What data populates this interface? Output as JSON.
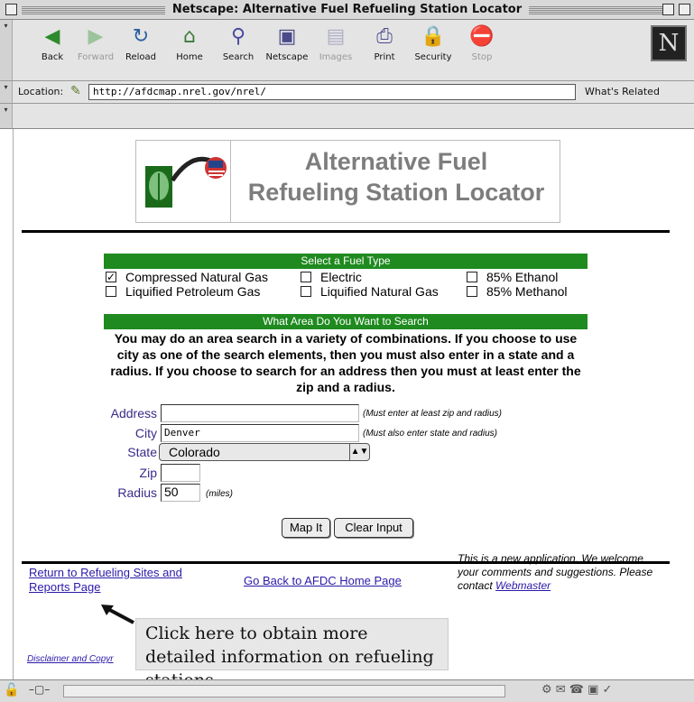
{
  "window": {
    "title": "Netscape: Alternative Fuel Refueling Station Locator"
  },
  "toolbar": {
    "buttons": [
      {
        "label": "Back",
        "icon": "back-arrow-icon",
        "enabled": true
      },
      {
        "label": "Forward",
        "icon": "forward-arrow-icon",
        "enabled": false
      },
      {
        "label": "Reload",
        "icon": "reload-icon",
        "enabled": true
      },
      {
        "label": "Home",
        "icon": "home-icon",
        "enabled": true
      },
      {
        "label": "Search",
        "icon": "search-icon",
        "enabled": true
      },
      {
        "label": "Netscape",
        "icon": "netscape-icon",
        "enabled": true
      },
      {
        "label": "Images",
        "icon": "images-icon",
        "enabled": false
      },
      {
        "label": "Print",
        "icon": "print-icon",
        "enabled": true
      },
      {
        "label": "Security",
        "icon": "security-lock-icon",
        "enabled": true
      },
      {
        "label": "Stop",
        "icon": "stop-icon",
        "enabled": false
      }
    ],
    "logo": "N"
  },
  "location": {
    "label": "Location:",
    "url": "http://afdcmap.nrel.gov/nrel/",
    "whats_related": "What's Related"
  },
  "banner": {
    "line1": "Alternative Fuel",
    "line2": "Refueling Station Locator"
  },
  "fuel_section": {
    "header": "Select a Fuel Type",
    "options": [
      {
        "label": "Compressed Natural Gas",
        "checked": true
      },
      {
        "label": "Electric",
        "checked": false
      },
      {
        "label": "85% Ethanol",
        "checked": false
      },
      {
        "label": "Liquified Petroleum Gas",
        "checked": false
      },
      {
        "label": "Liquified Natural Gas",
        "checked": false
      },
      {
        "label": "85% Methanol",
        "checked": false
      }
    ]
  },
  "area_section": {
    "header": "What Area Do You Want to Search",
    "help": "You may do an area search in a variety of combinations. If you choose to use city as one of the search elements, then you must also enter in a state and a radius. If you choose to search for an address then you must at least enter the zip and a radius."
  },
  "form": {
    "address_label": "Address",
    "address_value": "",
    "address_note": "(Must enter at least zip and radius)",
    "city_label": "City",
    "city_value": "Denver",
    "city_note": "(Must also enter state and radius)",
    "state_label": "State",
    "state_value": "Colorado",
    "zip_label": "Zip",
    "zip_value": "",
    "radius_label": "Radius",
    "radius_value": "50",
    "radius_unit": "(miles)",
    "map_button": "Map It",
    "clear_button": "Clear Input"
  },
  "footer": {
    "return_link": "Return to Refueling Sites and Reports Page",
    "home_link": "Go Back to AFDC Home Page",
    "feedback_text": "This is a new application. We welcome your comments and suggestions. Please contact",
    "webmaster_link": "Webmaster",
    "tooltip": "Click here to obtain more detailed information on refueling stations.",
    "disclaimer_link": "Disclaimer and Copyr"
  },
  "colors": {
    "green_bar": "#1f8a1f",
    "banner_text": "#7d7d7d",
    "link": "#2a1aa8",
    "label": "#3a2a8a"
  }
}
